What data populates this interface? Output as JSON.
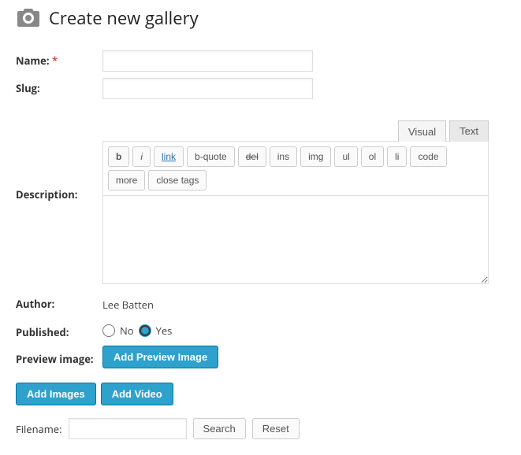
{
  "header": {
    "title": "Create new gallery"
  },
  "form": {
    "name": {
      "label": "Name:",
      "required": "*",
      "value": ""
    },
    "slug": {
      "label": "Slug:",
      "value": ""
    },
    "description": {
      "label": "Description:",
      "tabs": {
        "visual": "Visual",
        "text": "Text"
      },
      "quicktags": {
        "b": "b",
        "i": "i",
        "link": "link",
        "bquote": "b-quote",
        "del": "del",
        "ins": "ins",
        "img": "img",
        "ul": "ul",
        "ol": "ol",
        "li": "li",
        "code": "code",
        "more": "more",
        "close": "close tags"
      },
      "value": ""
    },
    "author": {
      "label": "Author:",
      "value": "Lee Batten"
    },
    "published": {
      "label": "Published:",
      "no": "No",
      "yes": "Yes",
      "value": "yes"
    },
    "preview_image": {
      "label": "Preview image:",
      "button": "Add Preview Image"
    }
  },
  "actions": {
    "add_images": "Add Images",
    "add_video": "Add Video"
  },
  "search": {
    "label": "Filename:",
    "value": "",
    "search_btn": "Search",
    "reset_btn": "Reset"
  }
}
